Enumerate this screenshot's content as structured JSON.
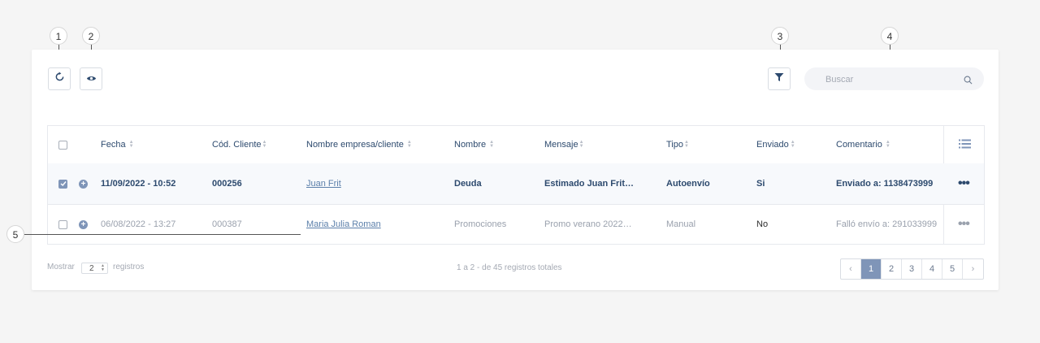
{
  "callouts": [
    "1",
    "2",
    "3",
    "4",
    "5"
  ],
  "toolbar": {
    "refresh_icon": "refresh-icon",
    "view_icon": "eye-icon",
    "filter_icon": "filter-icon"
  },
  "search": {
    "placeholder": "Buscar",
    "value": "",
    "icon": "search-icon"
  },
  "table": {
    "columns": [
      "Fecha",
      "Cód. Cliente",
      "Nombre empresa/cliente",
      "Nombre",
      "Mensaje",
      "Tipo",
      "Enviado",
      "Comentario"
    ],
    "column_menu_icon": "list-icon",
    "rows": [
      {
        "checked": true,
        "cells": [
          "11/09/2022 - 10:52",
          "000256",
          "Juan Frit",
          "Deuda",
          "Estimado Juan Frit…",
          "Autoenvío",
          "Si",
          "Enviado a: 1138473999"
        ],
        "actions": "•••"
      },
      {
        "checked": false,
        "cells": [
          "06/08/2022 - 13:27",
          "000387",
          "Maria Julia Roman",
          "Promociones",
          "Promo verano 2022…",
          "Manual",
          "No",
          "Falló envío a: 291033999"
        ],
        "actions": "•••"
      }
    ]
  },
  "footer": {
    "show_label": "Mostrar",
    "show_value": "2",
    "records_label": "registros",
    "summary": "1 a 2 - de 45 registros totales",
    "pager": {
      "prev": "‹",
      "pages": [
        "1",
        "2",
        "3",
        "4",
        "5"
      ],
      "next": "›",
      "active_page": "1"
    }
  },
  "colors": {
    "accent": "#7f95b8",
    "text": "#2d4a6e",
    "muted": "#9aa1ad",
    "background": "#f5f5f5"
  }
}
